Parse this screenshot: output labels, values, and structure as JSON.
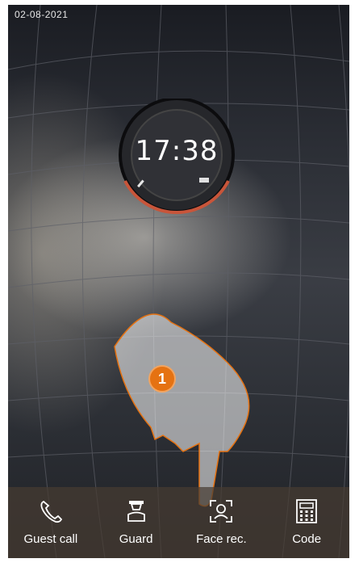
{
  "status": {
    "date": "02-08-2021"
  },
  "clock": {
    "time": "17:38"
  },
  "tutorial": {
    "step_marker": "1"
  },
  "bottom_bar": {
    "items": [
      {
        "label": "Guest call",
        "icon": "phone-icon"
      },
      {
        "label": "Guard",
        "icon": "guard-icon"
      },
      {
        "label": "Face rec.",
        "icon": "face-recognition-icon"
      },
      {
        "label": "Code",
        "icon": "keypad-icon"
      }
    ]
  },
  "colors": {
    "accent": "#e57212",
    "clock_ring": "#c8553a",
    "bar_bg": "#463c32"
  }
}
